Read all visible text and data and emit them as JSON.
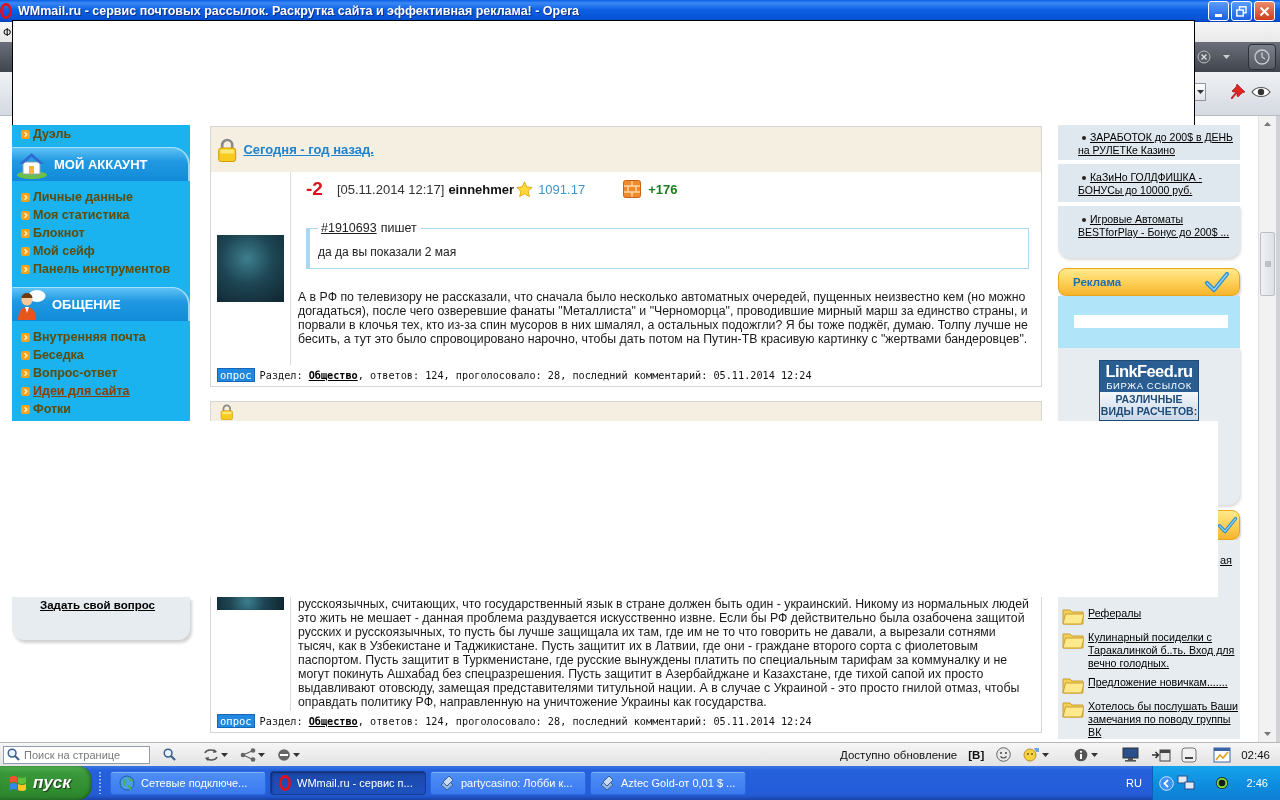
{
  "window": {
    "title": "WMmail.ru - сервис почтовых рассылок. Раскрутка сайта и эффективная реклама! - Opera"
  },
  "menu_bar": {
    "items": [
      "Ф"
    ]
  },
  "sidebar": {
    "top_items": [
      {
        "label": "Дуэль",
        "selected": false
      }
    ],
    "sections": [
      {
        "title": "МОЙ АККАУНТ",
        "items": [
          {
            "label": "Личные данные",
            "selected": false
          },
          {
            "label": "Моя статистика",
            "selected": false
          },
          {
            "label": "Блокнот",
            "selected": false
          },
          {
            "label": "Мой сейф",
            "selected": false
          },
          {
            "label": "Панель инструментов",
            "selected": false
          }
        ]
      },
      {
        "title": "ОБЩЕНИЕ",
        "items": [
          {
            "label": "Внутренняя почта",
            "selected": false
          },
          {
            "label": "Беседка",
            "selected": false
          },
          {
            "label": "Вопрос-ответ",
            "selected": false
          },
          {
            "label": "Идеи для сайта",
            "selected": true
          },
          {
            "label": "Фотки",
            "selected": false
          }
        ]
      }
    ],
    "ask_link": "Задать свой вопрос"
  },
  "posts": [
    {
      "title": "Сегодня - год назад.",
      "rating": "-2",
      "date": "[05.11.2014 12:17]",
      "author": "einnehmer",
      "score": "1091.17",
      "karma": "+176",
      "quote": {
        "ref": "#1910693",
        "verb": "пишет",
        "text": "да да вы показали 2 мая"
      },
      "text": "А в РФ по телевизору не рассказали, что сначала было несколько автоматных очередей, пущенных неизвестно кем (но можно догадаться), после чего озверевшие фанаты \"Металлиста\" и \"Черноморца\", проводившие мирный марш за единство страны, и порвали в клочья тех, кто из-за спин мусоров в них шмалял, а остальных подожгли? Я бы тоже поджёг, думаю. Толпу лучше не бесить, а тут это было спровоцировано нарочно, чтобы дать потом на Путин-ТВ красивую картинку с \"жертвами бандеровцев\".",
      "footer": {
        "tag": "опрос",
        "label": "Раздел:",
        "section": "Общество",
        "stats": ", ответов: 124, проголосовало: 28, последний комментарий: 05.11.2014 12:24"
      }
    },
    {
      "text": "русскоязычных, считающих, что государственный язык в стране должен быть один - украинский. Никому из нормальных людей это жить не мешает - данная проблема раздувается искусственно извне. Если бы РФ действительно была озабочена защитой русских и русскоязычных, то пусть бы лучше защищала их там, где им не то что говорить не давали, а вырезали сотнями тысяч, как в Узбекистане и Таджикистане. Пусть защитит их в Латвии, где они - граждане второго сорта с фиолетовым паспортом. Пусть защитит в Туркменистане, где русские вынуждены платить по специальным тарифам за коммуналку и не могут покинуть Ашхабад без спецразрешения. Пусть защитит в Азербайджане и Казахстане, где тихой сапой их просто выдавливают отовсюду, замещая представителями титульной нации. А в случае с Украиной - это просто гнилой отмаз, чтобы оправдать политику РФ, направленную на уничтожение Украины как государства.",
      "footer": {
        "tag": "опрос",
        "label": "Раздел:",
        "section": "Общество",
        "stats": ", ответов: 124, проголосовало: 28, последний комментарий: 05.11.2014 12:24"
      }
    }
  ],
  "right_sidebar": {
    "ads": [
      "ЗАРАБОТОК до 200$ в ДЕНЬ на РУЛЕТКе Казино",
      "КаЗиНо ГОЛДФИШКА - БОНУСы до 10000 руб.",
      "Игровые Автоматы BESTforPlay - Бонус до 200$ ..."
    ],
    "ad_panel": {
      "title": "Реклама",
      "banner": {
        "brand": "LinkFeed.ru",
        "subtitle": "БИРЖА ССЫЛОК",
        "lines": [
          "РАЗЛИЧНЫЕ",
          "ВИДЫ РАСЧЕТОВ:"
        ]
      }
    },
    "groups": {
      "fragment": "ая",
      "items": [
        "Рефералы",
        "Кулинарный посиделки с Таракалинкой б..ть. Вход для вечно голодных.",
        "Предложение новичкам.......",
        "Хотелось бы послушать Ваши замечания по поводу группы ВК"
      ]
    }
  },
  "status_bar": {
    "search": {
      "placeholder": "Поиск на странице"
    },
    "update": "Доступно обновление",
    "mode": "[B]",
    "time": "02:46"
  },
  "taskbar": {
    "start": "пуск",
    "tasks": [
      {
        "label": "Сетевые подключе...",
        "selected": false
      },
      {
        "label": "WMmail.ru - сервис п...",
        "selected": true
      },
      {
        "label": "partycasino: Лобби к...",
        "selected": false
      },
      {
        "label": "Aztec Gold-от 0,01 $ ...",
        "selected": false
      }
    ],
    "language": "RU",
    "clock": "2:46"
  }
}
